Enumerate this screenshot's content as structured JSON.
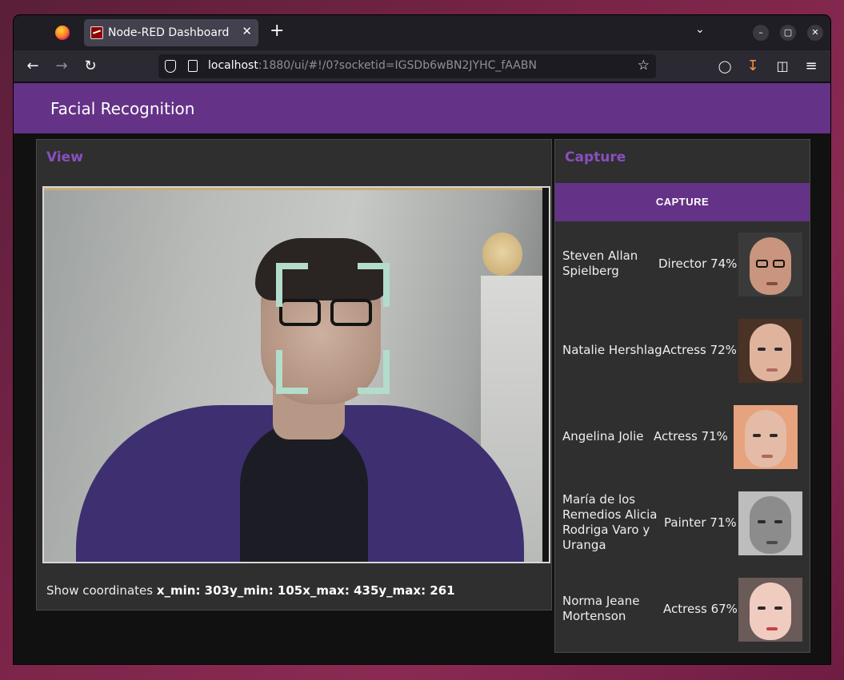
{
  "browser": {
    "tab_title": "Node-RED Dashboard",
    "tab_close": "✕",
    "new_tab": "+",
    "url_host": "localhost",
    "url_rest": ":1880/ui/#!/0?socketid=IGSDb6wBN2JYHC_fAABN",
    "window_controls": [
      "–",
      "▢",
      "✕"
    ],
    "icons": [
      "back-icon",
      "forward-icon",
      "reload-icon",
      "shield-icon",
      "page-icon",
      "bookmark-star-icon",
      "pocket-icon",
      "download-icon",
      "extensions-icon",
      "menu-icon"
    ]
  },
  "app": {
    "title": "Facial Recognition",
    "accent_color": "#643287"
  },
  "view": {
    "title": "View",
    "coords_label": "Show coordinates ",
    "coords_value": "x_min: 303y_min: 105x_max: 435y_max: 261"
  },
  "capture": {
    "title": "Capture",
    "button_label": "CAPTURE",
    "results": [
      {
        "name": "Steven Allan Spielberg",
        "job": "Director 74%"
      },
      {
        "name": "Natalie Hershlag",
        "job": "Actress 72%"
      },
      {
        "name": "Angelina Jolie",
        "job": "Actress  71%"
      },
      {
        "name": "María de los Remedios Alicia Rodriga Varo y Uranga",
        "job": "Painter 71%"
      },
      {
        "name": "Norma Jeane Mortenson",
        "job": "Actress 67%"
      }
    ]
  }
}
